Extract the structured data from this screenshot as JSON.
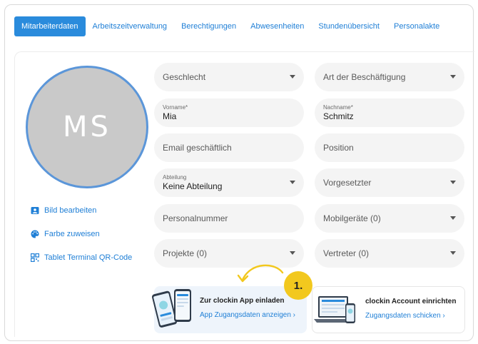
{
  "tabs": [
    {
      "label": "Mitarbeiterdaten",
      "active": true
    },
    {
      "label": "Arbeitszeitverwaltung"
    },
    {
      "label": "Berechtigungen"
    },
    {
      "label": "Abwesenheiten"
    },
    {
      "label": "Stundenübersicht"
    },
    {
      "label": "Personalakte"
    }
  ],
  "avatar": {
    "initials": "MS"
  },
  "side_links": {
    "edit_picture": "Bild bearbeiten",
    "assign_color": "Farbe zuweisen",
    "qr_code": "Tablet Terminal QR-Code"
  },
  "form": {
    "gender": {
      "placeholder": "Geschlecht"
    },
    "employment_type": {
      "placeholder": "Art der Beschäftigung"
    },
    "first_name": {
      "label": "Vorname*",
      "value": "Mia"
    },
    "last_name": {
      "label": "Nachname*",
      "value": "Schmitz"
    },
    "email": {
      "placeholder": "Email geschäftlich"
    },
    "position": {
      "placeholder": "Position"
    },
    "department": {
      "label": "Abteilung",
      "value": "Keine Abteilung"
    },
    "supervisor": {
      "placeholder": "Vorgesetzter"
    },
    "personnel_number": {
      "placeholder": "Personalnummer"
    },
    "mobile_devices": {
      "placeholder": "Mobilgeräte (0)"
    },
    "projects": {
      "placeholder": "Projekte (0)"
    },
    "substitute": {
      "placeholder": "Vertreter (0)"
    }
  },
  "cards": {
    "app": {
      "title": "Zur clockin App einladen",
      "link": "App Zugangsdaten anzeigen"
    },
    "account": {
      "title": "clockin Account einrichten",
      "link": "Zugangsdaten schicken"
    }
  },
  "annotation": {
    "step": "1.",
    "color": "#f2c81e"
  },
  "colors": {
    "accent": "#2a8bdc",
    "link": "#1f7fd6",
    "avatar_ring": "#5b96d9"
  }
}
